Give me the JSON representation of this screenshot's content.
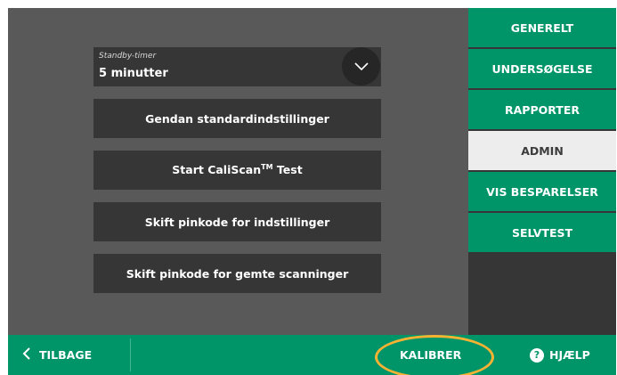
{
  "settings": {
    "standby": {
      "label": "Standby-timer",
      "value": "5 minutter",
      "icon": "chevron-down-icon"
    },
    "buttons": {
      "restore": "Gendan standardindstillinger",
      "caliscan_prefix": "Start CaliScan",
      "caliscan_tm": "TM",
      "caliscan_suffix": " Test",
      "pin_settings": "Skift pinkode for indstillinger",
      "pin_scans": "Skift pinkode for gemte scanninger"
    }
  },
  "sidebar": {
    "tabs": [
      "GENERELT",
      "UNDERSØGELSE",
      "RAPPORTER",
      "ADMIN",
      "VIS BESPARELSER",
      "SELVTEST"
    ],
    "active": "ADMIN"
  },
  "footer": {
    "back_label": "TILBAGE",
    "calibrate_label": "KALIBRER",
    "help_label": "HJÆLP",
    "help_icon_glyph": "?"
  },
  "colors": {
    "accent_green": "#009469",
    "highlight_ring": "#f5b233",
    "panel_dark": "#363636",
    "background_gray": "#595959"
  }
}
